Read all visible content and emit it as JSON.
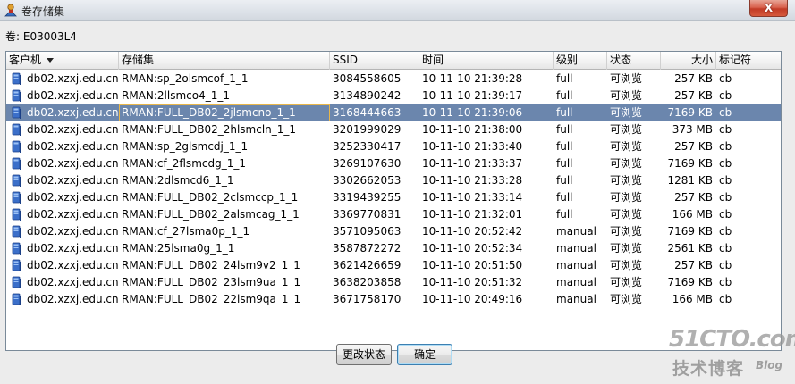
{
  "window": {
    "title": "卷存储集",
    "close_label": "X"
  },
  "volume": {
    "label": "卷: E03003L4"
  },
  "columns": [
    "客户机",
    "存储集",
    "SSID",
    "时间",
    "级别",
    "状态",
    "大小",
    "标记符"
  ],
  "rows": [
    [
      "db02.xzxj.edu.cn",
      "RMAN:sp_2olsmcof_1_1",
      "3084558605",
      "10-11-10 21:39:28",
      "full",
      "可浏览",
      "257 KB",
      "cb"
    ],
    [
      "db02.xzxj.edu.cn",
      "RMAN:2llsmco4_1_1",
      "3134890242",
      "10-11-10 21:39:17",
      "full",
      "可浏览",
      "257 KB",
      "cb"
    ],
    [
      "db02.xzxj.edu.cn",
      "RMAN:FULL_DB02_2jlsmcno_1_1",
      "3168444663",
      "10-11-10 21:39:06",
      "full",
      "可浏览",
      "7169 KB",
      "cb"
    ],
    [
      "db02.xzxj.edu.cn",
      "RMAN:FULL_DB02_2hlsmcln_1_1",
      "3201999029",
      "10-11-10 21:38:00",
      "full",
      "可浏览",
      "373 MB",
      "cb"
    ],
    [
      "db02.xzxj.edu.cn",
      "RMAN:sp_2glsmcdj_1_1",
      "3252330417",
      "10-11-10 21:33:40",
      "full",
      "可浏览",
      "257 KB",
      "cb"
    ],
    [
      "db02.xzxj.edu.cn",
      "RMAN:cf_2flsmcdg_1_1",
      "3269107630",
      "10-11-10 21:33:37",
      "full",
      "可浏览",
      "7169 KB",
      "cb"
    ],
    [
      "db02.xzxj.edu.cn",
      "RMAN:2dlsmcd6_1_1",
      "3302662053",
      "10-11-10 21:33:28",
      "full",
      "可浏览",
      "1281 KB",
      "cb"
    ],
    [
      "db02.xzxj.edu.cn",
      "RMAN:FULL_DB02_2clsmccp_1_1",
      "3319439255",
      "10-11-10 21:33:14",
      "full",
      "可浏览",
      "257 KB",
      "cb"
    ],
    [
      "db02.xzxj.edu.cn",
      "RMAN:FULL_DB02_2alsmcag_1_1",
      "3369770831",
      "10-11-10 21:32:01",
      "full",
      "可浏览",
      "166 MB",
      "cb"
    ],
    [
      "db02.xzxj.edu.cn",
      "RMAN:cf_27lsma0p_1_1",
      "3571095063",
      "10-11-10 20:52:42",
      "manual",
      "可浏览",
      "7169 KB",
      "cb"
    ],
    [
      "db02.xzxj.edu.cn",
      "RMAN:25lsma0g_1_1",
      "3587872272",
      "10-11-10 20:52:34",
      "manual",
      "可浏览",
      "2561 KB",
      "cb"
    ],
    [
      "db02.xzxj.edu.cn",
      "RMAN:FULL_DB02_24lsm9v2_1_1",
      "3621426659",
      "10-11-10 20:51:50",
      "manual",
      "可浏览",
      "257 KB",
      "cb"
    ],
    [
      "db02.xzxj.edu.cn",
      "RMAN:FULL_DB02_23lsm9ua_1_1",
      "3638203858",
      "10-11-10 20:51:32",
      "manual",
      "可浏览",
      "7169 KB",
      "cb"
    ],
    [
      "db02.xzxj.edu.cn",
      "RMAN:FULL_DB02_22lsm9qa_1_1",
      "3671758170",
      "10-11-10 20:49:16",
      "manual",
      "可浏览",
      "166 MB",
      "cb"
    ]
  ],
  "selected_row": 2,
  "buttons": {
    "change_status": "更改状态",
    "ok": "确定"
  },
  "watermark": {
    "main": "51CTO.com",
    "sub": "技术博客",
    "blog": "Blog"
  },
  "colors": {
    "selection": "#6b86ad",
    "close_button": "#c9452f",
    "default_button_border": "#3c7fb1"
  }
}
